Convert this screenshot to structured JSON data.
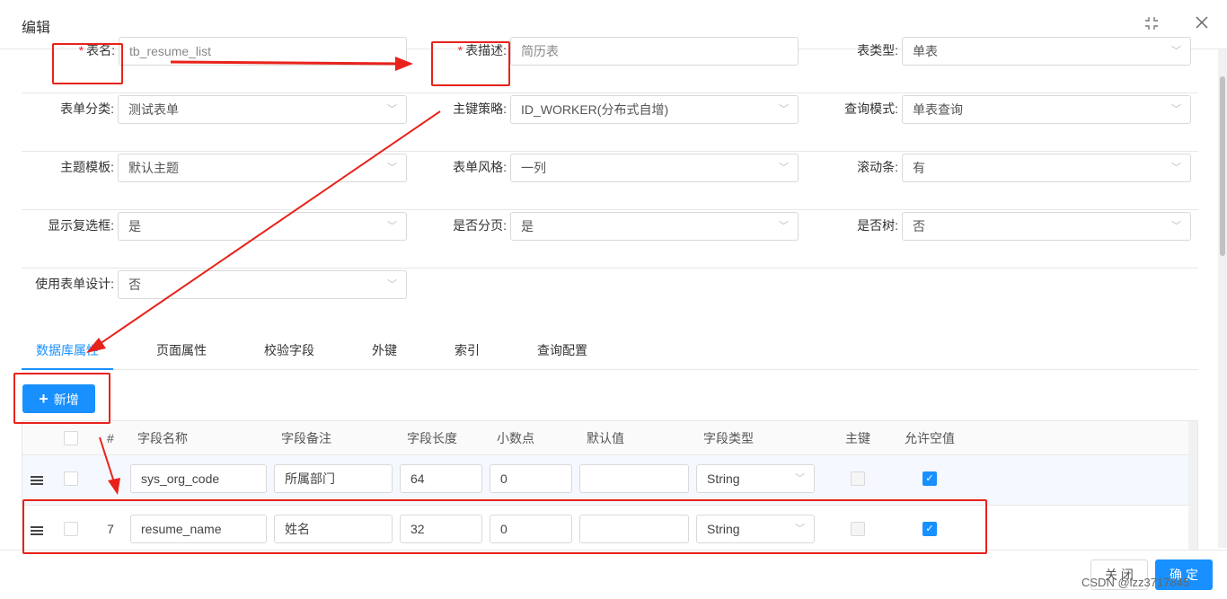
{
  "dialog": {
    "title": "编辑"
  },
  "form": {
    "table_name": {
      "label": "表名:",
      "value": "tb_resume_list"
    },
    "table_desc": {
      "label": "表描述:",
      "value": "简历表"
    },
    "table_type": {
      "label": "表类型:",
      "value": "单表"
    },
    "form_category": {
      "label": "表单分类:",
      "value": "测试表单"
    },
    "pk_strategy": {
      "label": "主键策略:",
      "value": "ID_WORKER(分布式自增)"
    },
    "query_mode": {
      "label": "查询模式:",
      "value": "单表查询"
    },
    "theme_template": {
      "label": "主题模板:",
      "value": "默认主题"
    },
    "form_style": {
      "label": "表单风格:",
      "value": "一列"
    },
    "scrollbar": {
      "label": "滚动条:",
      "value": "有"
    },
    "show_checkbox": {
      "label": "显示复选框:",
      "value": "是"
    },
    "paging": {
      "label": "是否分页:",
      "value": "是"
    },
    "is_tree": {
      "label": "是否树:",
      "value": "否"
    },
    "use_designer": {
      "label": "使用表单设计:",
      "value": "否"
    }
  },
  "tabs": [
    "数据库属性",
    "页面属性",
    "校验字段",
    "外键",
    "索引",
    "查询配置"
  ],
  "add_button": {
    "label": "新增"
  },
  "grid": {
    "headers": [
      "#",
      "字段名称",
      "字段备注",
      "字段长度",
      "小数点",
      "默认值",
      "字段类型",
      "主键",
      "允许空值"
    ],
    "rows": [
      {
        "num": "",
        "name": "sys_org_code",
        "comment": "所属部门",
        "length": "64",
        "decimal": "0",
        "default": "",
        "type": "String",
        "pk": false,
        "nullable": true
      },
      {
        "num": "7",
        "name": "resume_name",
        "comment": "姓名",
        "length": "32",
        "decimal": "0",
        "default": "",
        "type": "String",
        "pk": false,
        "nullable": true
      }
    ]
  },
  "footer": {
    "close": "关 闭",
    "ok": "确 定"
  },
  "watermark": "CSDN @lzz3717845",
  "colors": {
    "primary": "#1890ff",
    "annotation_red": "#e8221a",
    "required": "#f5222d"
  }
}
